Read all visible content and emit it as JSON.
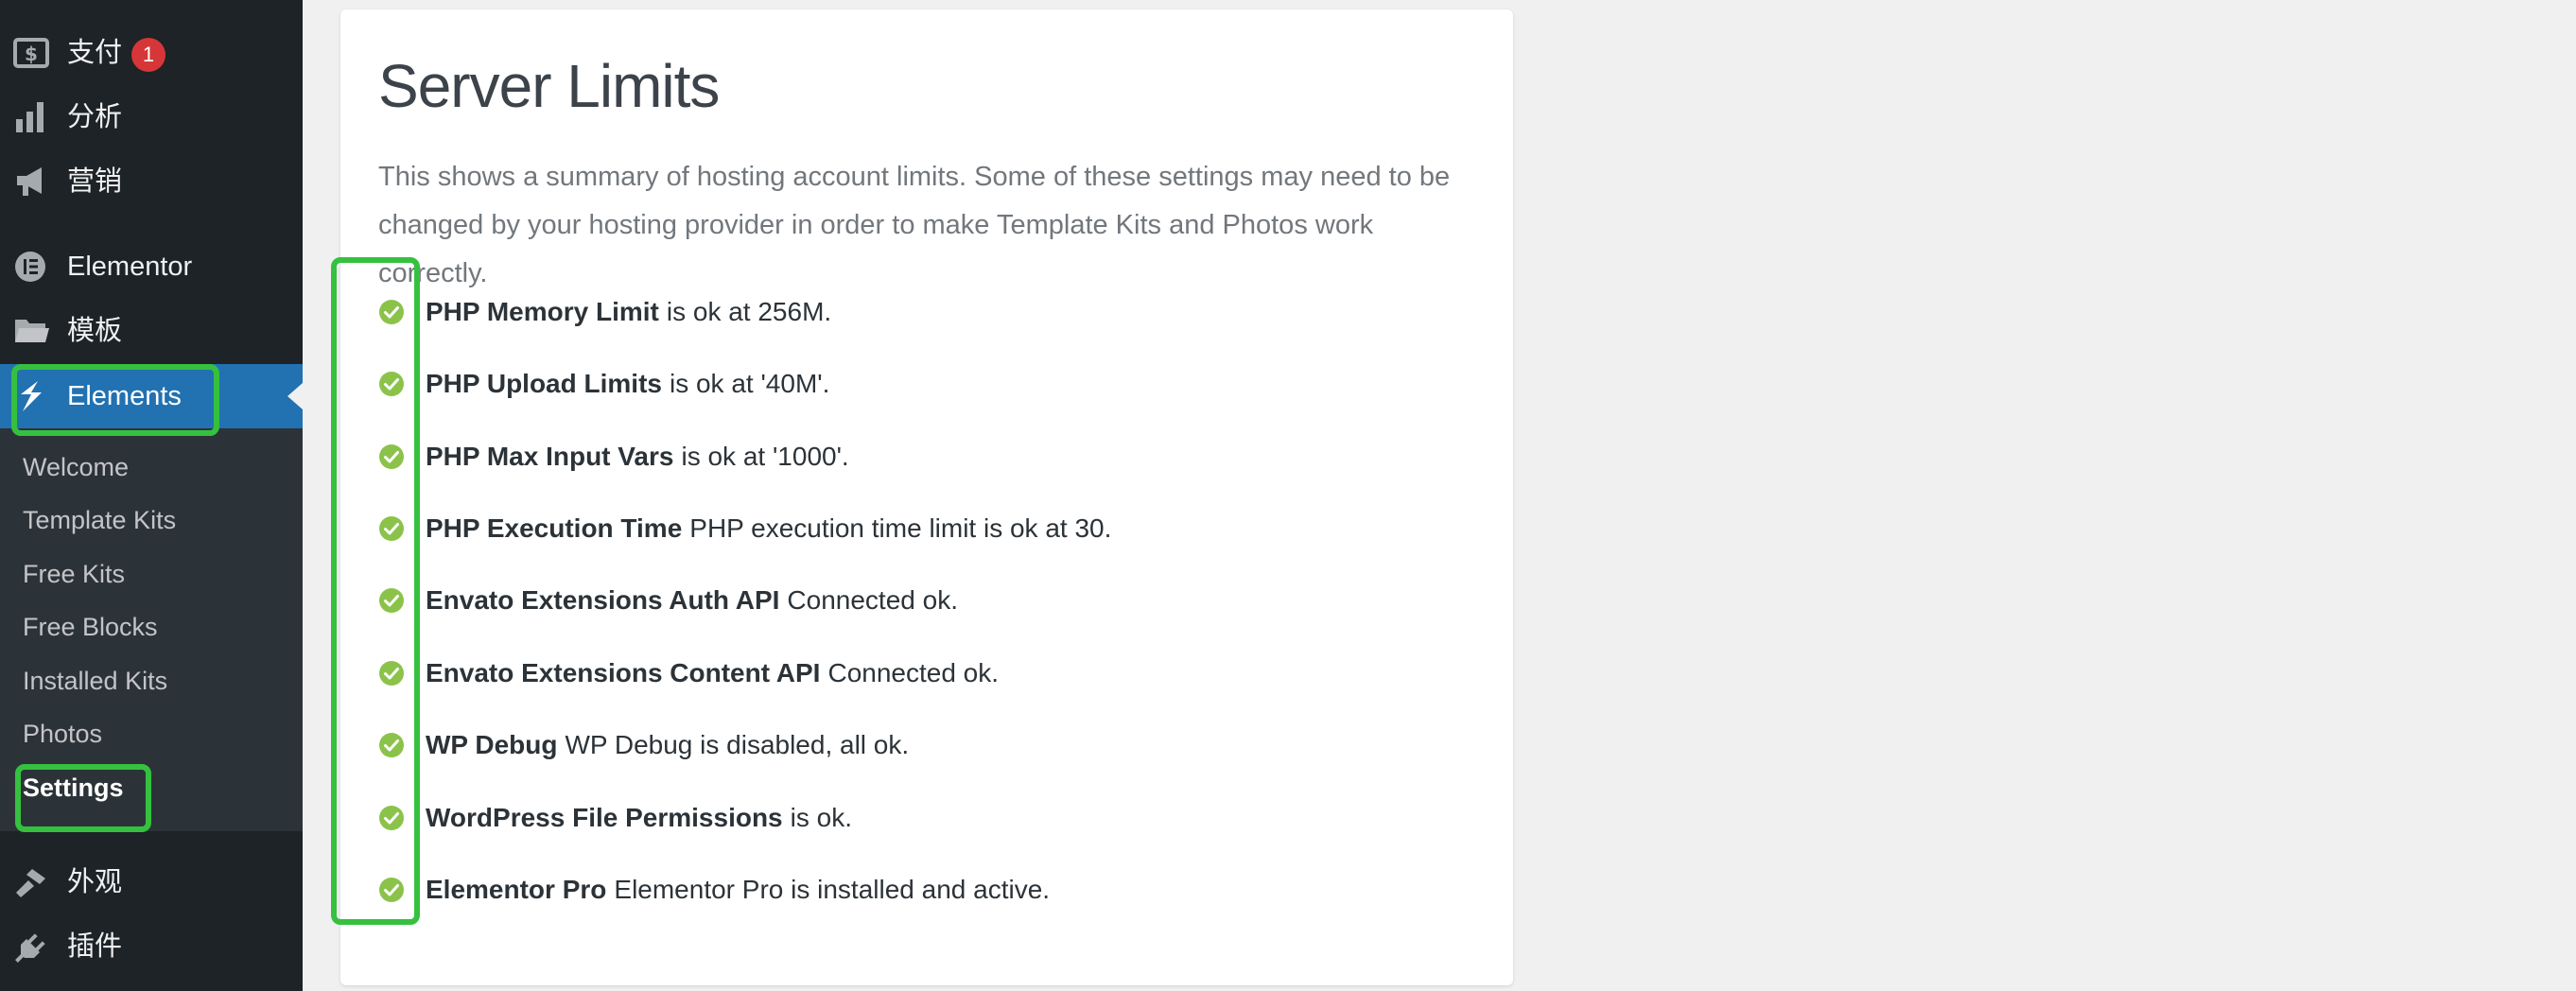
{
  "sidebar": {
    "menu": [
      {
        "label": "支付",
        "icon": "dollar-icon",
        "badge": "1"
      },
      {
        "label": "分析",
        "icon": "bar-chart-icon"
      },
      {
        "label": "营销",
        "icon": "megaphone-icon"
      },
      {
        "label": "Elementor",
        "icon": "elementor-icon"
      },
      {
        "label": "模板",
        "icon": "folder-icon"
      },
      {
        "label": "Elements",
        "icon": "elements-icon"
      },
      {
        "label": "外观",
        "icon": "paintbrush-icon"
      },
      {
        "label": "插件",
        "icon": "plugin-icon"
      }
    ],
    "submenu": [
      "Welcome",
      "Template Kits",
      "Free Kits",
      "Free Blocks",
      "Installed Kits",
      "Photos",
      "Settings"
    ]
  },
  "panel": {
    "title": "Server Limits",
    "description": "This shows a summary of hosting account limits. Some of these settings may need to be changed by your hosting provider in order to make Template Kits and Photos work correctly.",
    "checks": [
      {
        "name": "PHP Memory Limit",
        "message": "is ok at 256M."
      },
      {
        "name": "PHP Upload Limits",
        "message": "is ok at '40M'."
      },
      {
        "name": "PHP Max Input Vars",
        "message": "is ok at '1000'."
      },
      {
        "name": "PHP Execution Time",
        "message": "PHP execution time limit is ok at 30."
      },
      {
        "name": "Envato Extensions Auth API",
        "message": "Connected ok."
      },
      {
        "name": "Envato Extensions Content API",
        "message": "Connected ok."
      },
      {
        "name": "WP Debug",
        "message": "WP Debug is disabled, all ok."
      },
      {
        "name": "WordPress File Permissions",
        "message": "is ok."
      },
      {
        "name": "Elementor Pro",
        "message": "Elementor Pro is installed and active."
      }
    ]
  },
  "colors": {
    "sidebar_bg": "#1d2327",
    "submenu_bg": "#2c3338",
    "active_bg": "#2271b1",
    "highlight": "#35c13f",
    "check_green": "#8bc34a",
    "badge_red": "#d63638"
  }
}
